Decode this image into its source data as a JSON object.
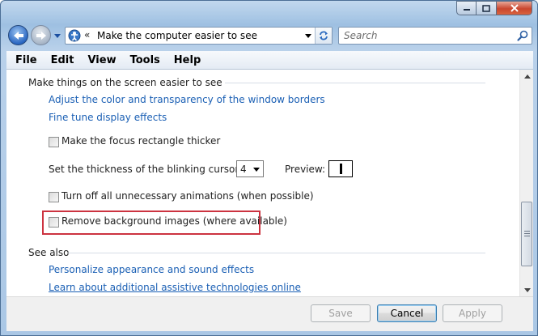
{
  "address": {
    "chevron": "«",
    "path": "Make the computer easier to see"
  },
  "search": {
    "placeholder": "Search"
  },
  "menu": [
    "File",
    "Edit",
    "View",
    "Tools",
    "Help"
  ],
  "section_screen": {
    "title": "Make things on the screen easier to see",
    "link_color": "Adjust the color and transparency of the window borders",
    "link_effects": "Fine tune display effects",
    "focus_rect_label": "Make the focus rectangle thicker",
    "cursor_label": "Set the thickness of the blinking cursor:",
    "cursor_value": "4",
    "preview_label": "Preview:",
    "animations_label": "Turn off all unnecessary animations (when possible)",
    "bg_images_label": "Remove background images (where available)"
  },
  "section_see_also": {
    "title": "See also",
    "link_personalize": "Personalize appearance and sound effects",
    "link_assistive": "Learn about additional assistive technologies online"
  },
  "buttons": {
    "save": "Save",
    "cancel": "Cancel",
    "apply": "Apply"
  },
  "colors": {
    "link": "#1a5fb4",
    "highlight": "#cc3340",
    "frame": "#9ec0e2"
  }
}
